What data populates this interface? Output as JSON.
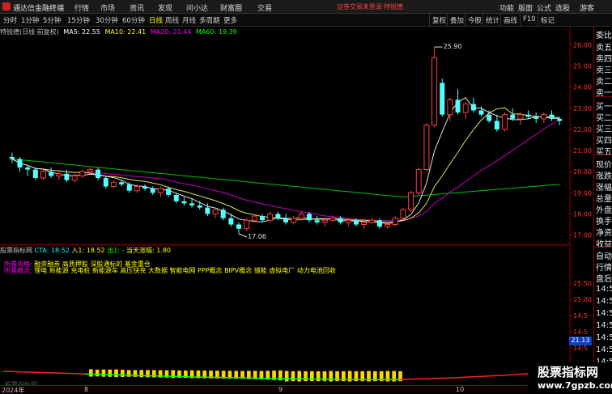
{
  "titlebar": {
    "app_name": "通达信金融终端",
    "menus": [
      "行情",
      "市场",
      "资讯",
      "发现",
      "问小达",
      "财富圈",
      "交易"
    ],
    "login_notice": "证券交易未登录",
    "trader_link": "特锐德",
    "right_menus": [
      "功能",
      "版面",
      "公式",
      "选股",
      "游客"
    ]
  },
  "toolbar": {
    "periods": [
      "分时",
      "1分钟",
      "5分钟",
      "15分钟",
      "30分钟",
      "60分钟",
      "日线",
      "周线",
      "月线",
      "多周期",
      "更多"
    ],
    "active_period": "日线",
    "right_buttons": [
      "复权",
      "叠加",
      "今股",
      "统计",
      "画线",
      "F10",
      "标记"
    ]
  },
  "ma_header": {
    "stock": "特锐德(日线 前复权)",
    "ma5": "MA5: 22.55",
    "ma10": "MA10: 22.41",
    "ma20": "MA20: 21.44",
    "ma60": "MA60: 19.39",
    "colors": {
      "ma5": "#ffffff",
      "ma10": "#ffff00",
      "ma20": "#ff00ff",
      "ma60": "#00ff00",
      "stock": "#c0c0c0"
    }
  },
  "sub_header": {
    "name": "股票指标网",
    "cta": "CTA: 18.52",
    "entry": "入1: 18.52",
    "exit": "出1: -",
    "gain": "当天涨幅: 1.80"
  },
  "concepts": {
    "industry_label": "所属风格:",
    "industry": "融资融券 高质押股 深股通标的 基金重仓",
    "concept_label": "所属概念:",
    "concept": "锂电 新能源 充电桩 新能源车 高压快充 大数据 智能电网 PPP概念 BIPV概念 储能 虚拟电厂 动力电池回收"
  },
  "time_axis": {
    "labels": [
      "2024年",
      "8",
      "9",
      "10"
    ]
  },
  "right_panel": {
    "labels": [
      "委比",
      "卖五",
      "卖四",
      "卖三",
      "卖二",
      "卖一",
      "买一",
      "买二",
      "买三",
      "买四",
      "买五",
      "现价",
      "涨跌",
      "涨幅",
      "总量",
      "外盘",
      "换手",
      "净资",
      "收益",
      "自动",
      "行情",
      "盘后",
      "14:5",
      "14:5",
      "14:5",
      "14:5",
      "14:5",
      "14:5",
      "14:5",
      "14:5",
      "14:5"
    ]
  },
  "price_tag": "21.13",
  "watermark": {
    "small": "股票指标网",
    "brand_title": "股票指标网",
    "brand_url": "www.7gpzb.com"
  },
  "chart_data": [
    {
      "type": "candlestick",
      "title": "特锐德(日线 前复权)",
      "y_axis_labels": [
        "26.00",
        "25.00",
        "24.00",
        "23.00",
        "22.00",
        "21.00",
        "20.00",
        "19.00",
        "18.00",
        "17.00"
      ],
      "ylim": [
        16.6,
        26.4
      ],
      "annotations": [
        {
          "text": "25.90",
          "candle": 54
        },
        {
          "text": "17.06",
          "candle": 29
        }
      ],
      "candles": [
        [
          20.7,
          20.9,
          20.4,
          20.6
        ],
        [
          20.6,
          20.7,
          20.0,
          20.2
        ],
        [
          20.2,
          20.3,
          19.8,
          20.1
        ],
        [
          20.1,
          20.2,
          19.6,
          19.7
        ],
        [
          19.7,
          20.1,
          19.6,
          20.0
        ],
        [
          20.0,
          20.2,
          19.7,
          19.8
        ],
        [
          19.8,
          20.0,
          19.6,
          19.9
        ],
        [
          19.9,
          20.1,
          19.5,
          19.6
        ],
        [
          19.6,
          19.9,
          19.5,
          19.8
        ],
        [
          19.8,
          20.1,
          19.7,
          20.0
        ],
        [
          20.0,
          20.2,
          19.9,
          20.1
        ],
        [
          20.1,
          20.2,
          19.6,
          19.7
        ],
        [
          19.7,
          19.8,
          19.2,
          19.3
        ],
        [
          19.3,
          19.6,
          19.2,
          19.5
        ],
        [
          19.5,
          19.6,
          19.3,
          19.4
        ],
        [
          19.4,
          19.5,
          19.0,
          19.1
        ],
        [
          19.1,
          19.4,
          19.0,
          19.3
        ],
        [
          19.3,
          19.4,
          19.1,
          19.2
        ],
        [
          19.2,
          19.3,
          18.9,
          19.0
        ],
        [
          19.0,
          19.3,
          18.8,
          19.2
        ],
        [
          19.2,
          19.3,
          18.8,
          18.9
        ],
        [
          18.9,
          19.0,
          18.5,
          18.6
        ],
        [
          18.6,
          18.8,
          18.4,
          18.5
        ],
        [
          18.5,
          18.7,
          18.3,
          18.4
        ],
        [
          18.4,
          18.6,
          18.2,
          18.3
        ],
        [
          18.3,
          18.5,
          17.9,
          18.0
        ],
        [
          18.0,
          18.3,
          17.8,
          18.2
        ],
        [
          18.2,
          18.3,
          17.7,
          17.8
        ],
        [
          17.8,
          18.0,
          17.4,
          17.5
        ],
        [
          17.5,
          17.6,
          17.06,
          17.3
        ],
        [
          17.3,
          17.8,
          17.2,
          17.7
        ],
        [
          17.7,
          18.0,
          17.6,
          17.9
        ],
        [
          17.9,
          18.0,
          17.6,
          17.7
        ],
        [
          17.7,
          18.1,
          17.6,
          18.0
        ],
        [
          18.0,
          18.1,
          17.7,
          17.8
        ],
        [
          17.8,
          18.0,
          17.5,
          17.6
        ],
        [
          17.6,
          17.9,
          17.5,
          17.8
        ],
        [
          17.8,
          18.1,
          17.7,
          18.0
        ],
        [
          18.0,
          18.1,
          17.6,
          17.7
        ],
        [
          17.7,
          17.9,
          17.5,
          17.6
        ],
        [
          17.6,
          17.8,
          17.4,
          17.7
        ],
        [
          17.7,
          17.9,
          17.6,
          17.8
        ],
        [
          17.8,
          17.9,
          17.5,
          17.6
        ],
        [
          17.6,
          17.8,
          17.4,
          17.7
        ],
        [
          17.7,
          17.8,
          17.4,
          17.5
        ],
        [
          17.5,
          17.7,
          17.3,
          17.6
        ],
        [
          17.6,
          17.8,
          17.5,
          17.7
        ],
        [
          17.7,
          17.8,
          17.3,
          17.4
        ],
        [
          17.4,
          17.6,
          17.3,
          17.5
        ],
        [
          17.5,
          17.9,
          17.4,
          17.8
        ],
        [
          17.8,
          18.3,
          17.7,
          18.2
        ],
        [
          18.2,
          19.1,
          18.1,
          19.0
        ],
        [
          19.0,
          20.2,
          18.9,
          20.1
        ],
        [
          20.1,
          22.3,
          20.0,
          22.2
        ],
        [
          22.2,
          25.9,
          22.1,
          25.4
        ],
        [
          24.2,
          24.4,
          22.6,
          22.7
        ],
        [
          22.7,
          23.5,
          22.4,
          23.4
        ],
        [
          23.4,
          23.9,
          22.7,
          22.8
        ],
        [
          22.8,
          23.3,
          22.5,
          23.2
        ],
        [
          23.2,
          23.5,
          22.8,
          22.9
        ],
        [
          22.9,
          23.1,
          22.6,
          22.7
        ],
        [
          22.7,
          22.9,
          22.3,
          22.4
        ],
        [
          22.4,
          22.7,
          21.9,
          22.0
        ],
        [
          22.0,
          22.8,
          21.9,
          22.7
        ],
        [
          22.7,
          23.0,
          22.4,
          22.5
        ],
        [
          22.5,
          22.8,
          22.2,
          22.7
        ],
        [
          22.7,
          22.9,
          22.5,
          22.6
        ],
        [
          22.6,
          22.8,
          22.3,
          22.5
        ],
        [
          22.5,
          22.8,
          22.3,
          22.7
        ],
        [
          22.7,
          22.9,
          22.4,
          22.5
        ],
        [
          22.5,
          22.6,
          22.2,
          22.4
        ]
      ]
    },
    {
      "type": "bar",
      "title": "股票指标网",
      "y_axis_labels": [
        "25.50",
        "25.00",
        "14:5",
        "14:5",
        "14:5",
        "21.13",
        "14:5"
      ],
      "values": [
        0.9,
        0.8,
        0.9,
        0.9,
        1.0,
        0.9,
        0.8,
        0.8,
        0.9,
        0.9,
        0.9,
        0.9,
        0.9,
        1.0,
        0.9,
        0.9,
        1.0,
        1.0,
        1.0,
        1.0,
        1.0,
        1.0,
        1.0,
        1.0,
        1.0,
        1.1,
        1.1,
        1.1,
        1.2,
        1.3,
        1.4,
        1.5,
        1.4,
        1.5,
        1.4,
        1.4,
        1.4,
        1.4,
        1.5,
        1.4,
        1.4,
        1.5,
        1.4,
        1.4,
        1.5,
        1.4,
        1.4,
        1.5,
        1.5,
        1.4
      ]
    }
  ]
}
